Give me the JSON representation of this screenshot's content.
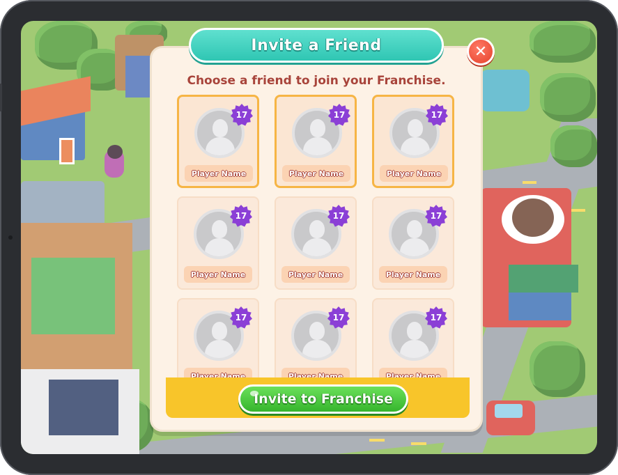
{
  "modal": {
    "title": "Invite a Friend",
    "subtitle": "Choose a friend to join your Franchise.",
    "close_icon": "close-icon",
    "invite_button_label": "Invite to Franchise"
  },
  "friends": [
    {
      "name": "Player Name",
      "level": "17",
      "selected": true
    },
    {
      "name": "Player Name",
      "level": "17",
      "selected": true
    },
    {
      "name": "Player Name",
      "level": "17",
      "selected": true
    },
    {
      "name": "Player Name",
      "level": "17",
      "selected": false
    },
    {
      "name": "Player Name",
      "level": "17",
      "selected": false
    },
    {
      "name": "Player Name",
      "level": "17",
      "selected": false
    },
    {
      "name": "Player Name",
      "level": "17",
      "selected": false
    },
    {
      "name": "Player Name",
      "level": "17",
      "selected": false
    },
    {
      "name": "Player Name",
      "level": "17",
      "selected": false
    }
  ],
  "colors": {
    "title_banner": "#2fc6b3",
    "subtitle": "#a8443b",
    "level_badge": "#8b3fd6",
    "invite_button": "#36b52d",
    "footer_bar": "#f8c52a",
    "close_button": "#e5412b"
  }
}
